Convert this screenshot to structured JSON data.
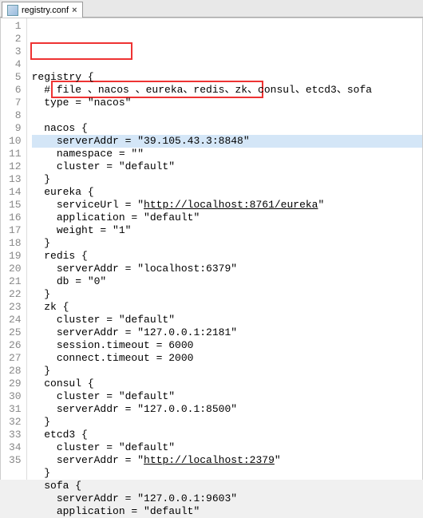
{
  "tab": {
    "filename": "registry.conf",
    "close": "×"
  },
  "lines": [
    {
      "n": 1,
      "t": "registry {"
    },
    {
      "n": 2,
      "t": "  # file 、nacos 、eureka、redis、zk、consul、etcd3、sofa"
    },
    {
      "n": 3,
      "t": "  type = \"nacos\""
    },
    {
      "n": 4,
      "t": ""
    },
    {
      "n": 5,
      "t": "  nacos {"
    },
    {
      "n": 6,
      "t": "    serverAddr = \"39.105.43.3:8848\"",
      "hl": true
    },
    {
      "n": 7,
      "t": "    namespace = \"\""
    },
    {
      "n": 8,
      "t": "    cluster = \"default\""
    },
    {
      "n": 9,
      "t": "  }"
    },
    {
      "n": 10,
      "t": "  eureka {"
    },
    {
      "n": 11,
      "t": "    serviceUrl = \"",
      "url": "http://localhost:8761/eureka",
      "after": "\""
    },
    {
      "n": 12,
      "t": "    application = \"default\""
    },
    {
      "n": 13,
      "t": "    weight = \"1\""
    },
    {
      "n": 14,
      "t": "  }"
    },
    {
      "n": 15,
      "t": "  redis {"
    },
    {
      "n": 16,
      "t": "    serverAddr = \"localhost:6379\""
    },
    {
      "n": 17,
      "t": "    db = \"0\""
    },
    {
      "n": 18,
      "t": "  }"
    },
    {
      "n": 19,
      "t": "  zk {"
    },
    {
      "n": 20,
      "t": "    cluster = \"default\""
    },
    {
      "n": 21,
      "t": "    serverAddr = \"127.0.0.1:2181\""
    },
    {
      "n": 22,
      "t": "    session.timeout = 6000"
    },
    {
      "n": 23,
      "t": "    connect.timeout = 2000"
    },
    {
      "n": 24,
      "t": "  }"
    },
    {
      "n": 25,
      "t": "  consul {"
    },
    {
      "n": 26,
      "t": "    cluster = \"default\""
    },
    {
      "n": 27,
      "t": "    serverAddr = \"127.0.0.1:8500\""
    },
    {
      "n": 28,
      "t": "  }"
    },
    {
      "n": 29,
      "t": "  etcd3 {"
    },
    {
      "n": 30,
      "t": "    cluster = \"default\""
    },
    {
      "n": 31,
      "t": "    serverAddr = \"",
      "url": "http://localhost:2379",
      "after": "\""
    },
    {
      "n": 32,
      "t": "  }"
    },
    {
      "n": 33,
      "t": "  sofa {"
    },
    {
      "n": 34,
      "t": "    serverAddr = \"127.0.0.1:9603\""
    },
    {
      "n": 35,
      "t": "    application = \"default\""
    }
  ]
}
